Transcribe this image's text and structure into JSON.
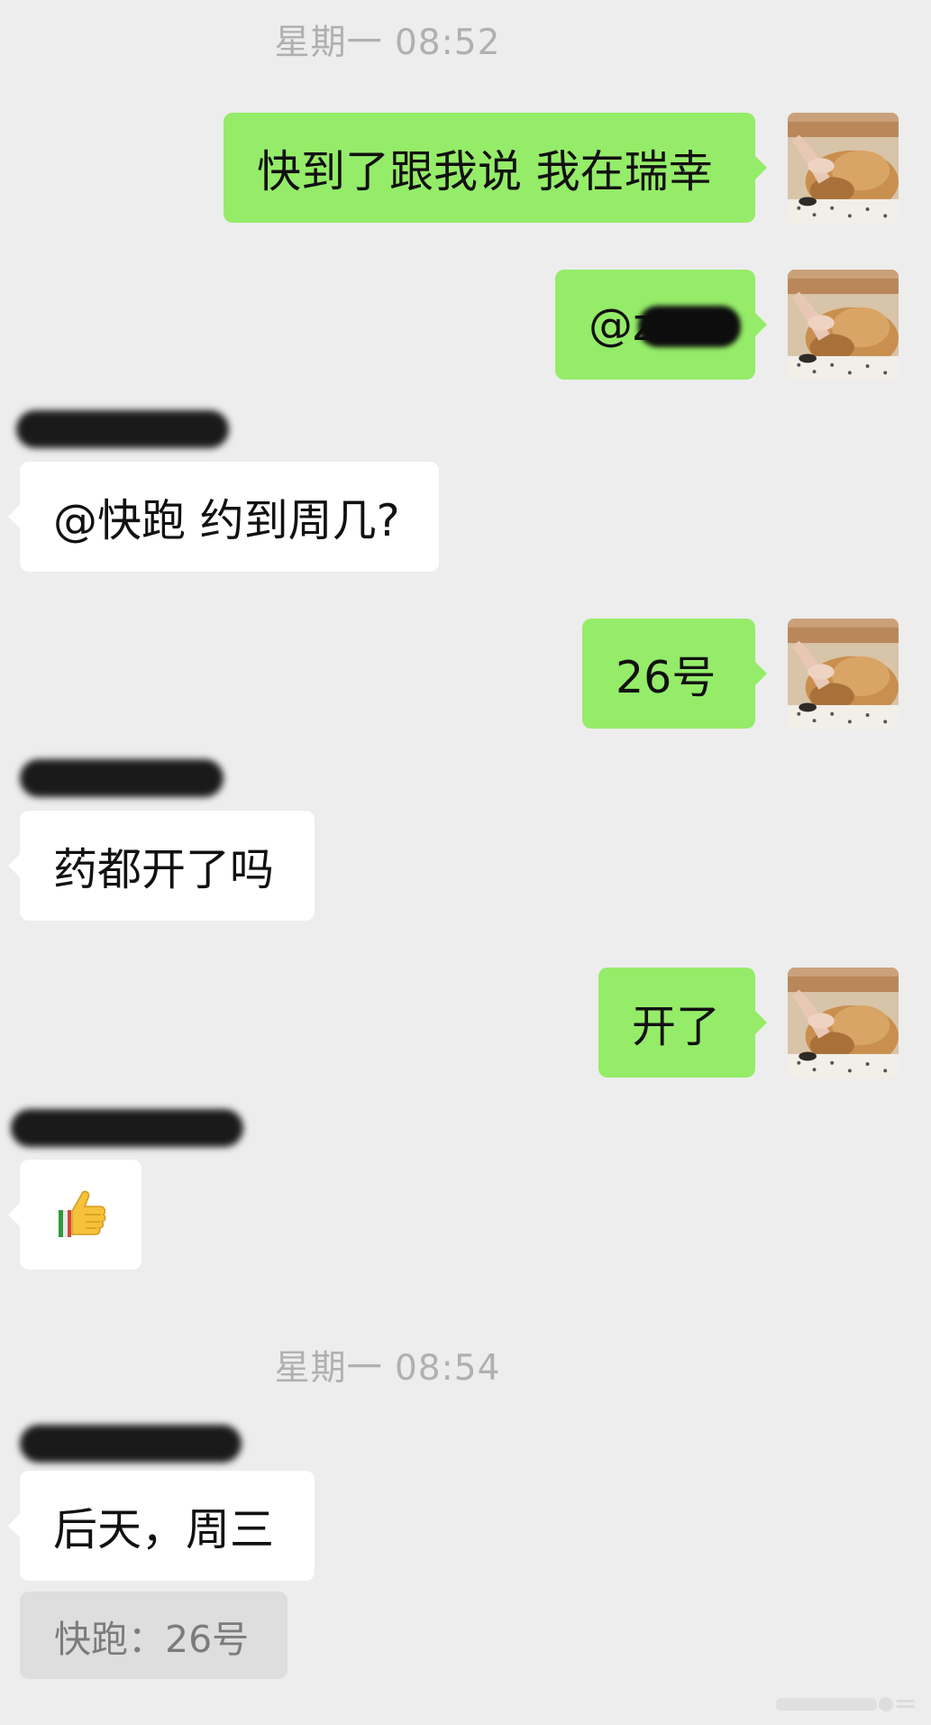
{
  "chat": {
    "messages": [
      {
        "type": "time",
        "text": "星期一 08:52"
      },
      {
        "type": "message",
        "direction": "out",
        "text": "快到了跟我说 我在瑞幸"
      },
      {
        "type": "message",
        "direction": "out",
        "text": "@z"
      },
      {
        "type": "message",
        "direction": "in",
        "text": "@快跑 约到周几?"
      },
      {
        "type": "message",
        "direction": "out",
        "text": "26号"
      },
      {
        "type": "message",
        "direction": "in",
        "text": "药都开了吗"
      },
      {
        "type": "message",
        "direction": "out",
        "text": "开了"
      },
      {
        "type": "message",
        "direction": "in",
        "emoji": "thumbs-up"
      },
      {
        "type": "time",
        "text": "星期一 08:54"
      },
      {
        "type": "message",
        "direction": "in",
        "text": "后天，周三"
      },
      {
        "type": "quote",
        "text": "快跑：26号"
      }
    ]
  },
  "colors": {
    "background": "#ededed",
    "outgoing_bubble": "#95ec69",
    "incoming_bubble": "#ffffff",
    "quote_bubble": "#dedede",
    "timestamp_text": "#b0b0b0",
    "quote_text": "#7c7c7c"
  },
  "icons": {
    "avatar": "cat-photo-avatar",
    "emoji": "thumbs-up-icon"
  }
}
